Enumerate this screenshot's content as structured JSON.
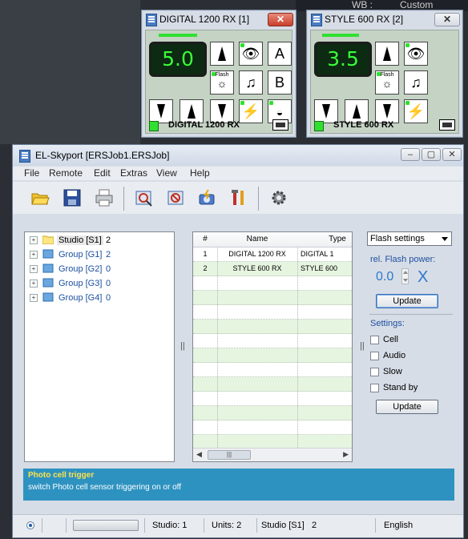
{
  "background": {
    "top_right_text": [
      "WB :",
      "Custom"
    ]
  },
  "remotes": [
    {
      "title": "DIGITAL 1200 RX [1]",
      "display_value": "5.0",
      "footer_name": "DIGITAL 1200 RX",
      "button_letters": [
        "A",
        "B"
      ],
      "flash_label": "Flash"
    },
    {
      "title": "STYLE 600 RX [2]",
      "display_value": "3.5",
      "footer_name": "STYLE 600 RX",
      "flash_label": "Flash"
    }
  ],
  "window": {
    "title": "EL-Skyport [ERSJob1.ERSJob]",
    "menu": [
      "File",
      "Remote",
      "Edit",
      "Extras",
      "View",
      "Help"
    ]
  },
  "tree": [
    {
      "label": "Studio [S1]",
      "count": "2",
      "selected": true
    },
    {
      "label": "Group [G1]",
      "count": "2"
    },
    {
      "label": "Group [G2]",
      "count": "0"
    },
    {
      "label": "Group [G3]",
      "count": "0"
    },
    {
      "label": "Group [G4]",
      "count": "0"
    }
  ],
  "table": {
    "headers": [
      "#",
      "Name",
      "Type"
    ],
    "rows": [
      [
        "1",
        "DIGITAL 1200 RX",
        "DIGITAL 1"
      ],
      [
        "2",
        "STYLE 600 RX",
        "STYLE 600"
      ]
    ]
  },
  "right_panel": {
    "dropdown_value": "Flash settings",
    "power_label": "rel. Flash power:",
    "power_value": "0.0",
    "power_x": "X",
    "update_label": "Update",
    "settings_label": "Settings:",
    "checkboxes": [
      "Cell",
      "Audio",
      "Slow",
      "Stand by"
    ],
    "update2_label": "Update"
  },
  "info": {
    "title": "Photo cell trigger",
    "description": "switch Photo cell sensor triggering on or off"
  },
  "status": {
    "studio": "Studio: 1",
    "units": "Units: 2",
    "studio_name": "Studio [S1]",
    "studio_count": "2",
    "language": "English"
  },
  "colors": {
    "accent_blue": "#2b78cf",
    "lcd_green": "#38ff38",
    "info_bar": "#2e92c1",
    "info_title": "#ffe24a"
  }
}
